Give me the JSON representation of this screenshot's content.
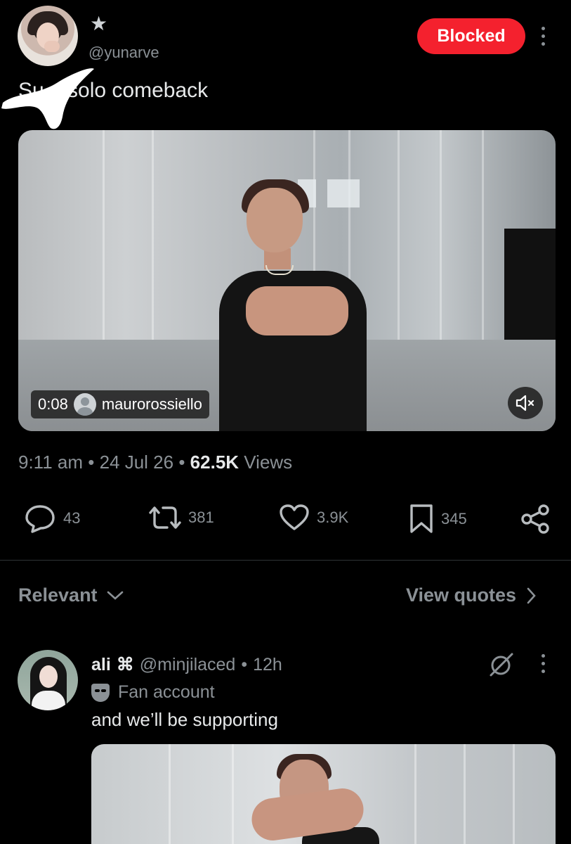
{
  "post": {
    "author_handle": "@yunarve",
    "star_icon": "star-icon",
    "blocked_label": "Blocked",
    "text": "Su  o solo comeback",
    "video": {
      "time": "0:08",
      "credit": "maurorossiello",
      "mute_icon": "volume-mute-icon"
    },
    "time": "9:11 am",
    "date": "24 Jul 26",
    "views_count": "62.5K",
    "views_label": "Views",
    "actions": {
      "replies": "43",
      "reposts": "381",
      "likes": "3.9K",
      "bookmarks": "345"
    }
  },
  "replies_bar": {
    "sort_label": "Relevant",
    "quotes_label": "View quotes"
  },
  "reply": {
    "name": "ali",
    "name_symbol": "⌘",
    "handle": "@minjilaced",
    "time": "12h",
    "badge": "Fan account",
    "text": "and we’ll be supporting"
  },
  "colors": {
    "background": "#000000",
    "blocked": "#f4212e",
    "secondary_text": "#8b9196",
    "primary_text": "#e7e9ea"
  }
}
